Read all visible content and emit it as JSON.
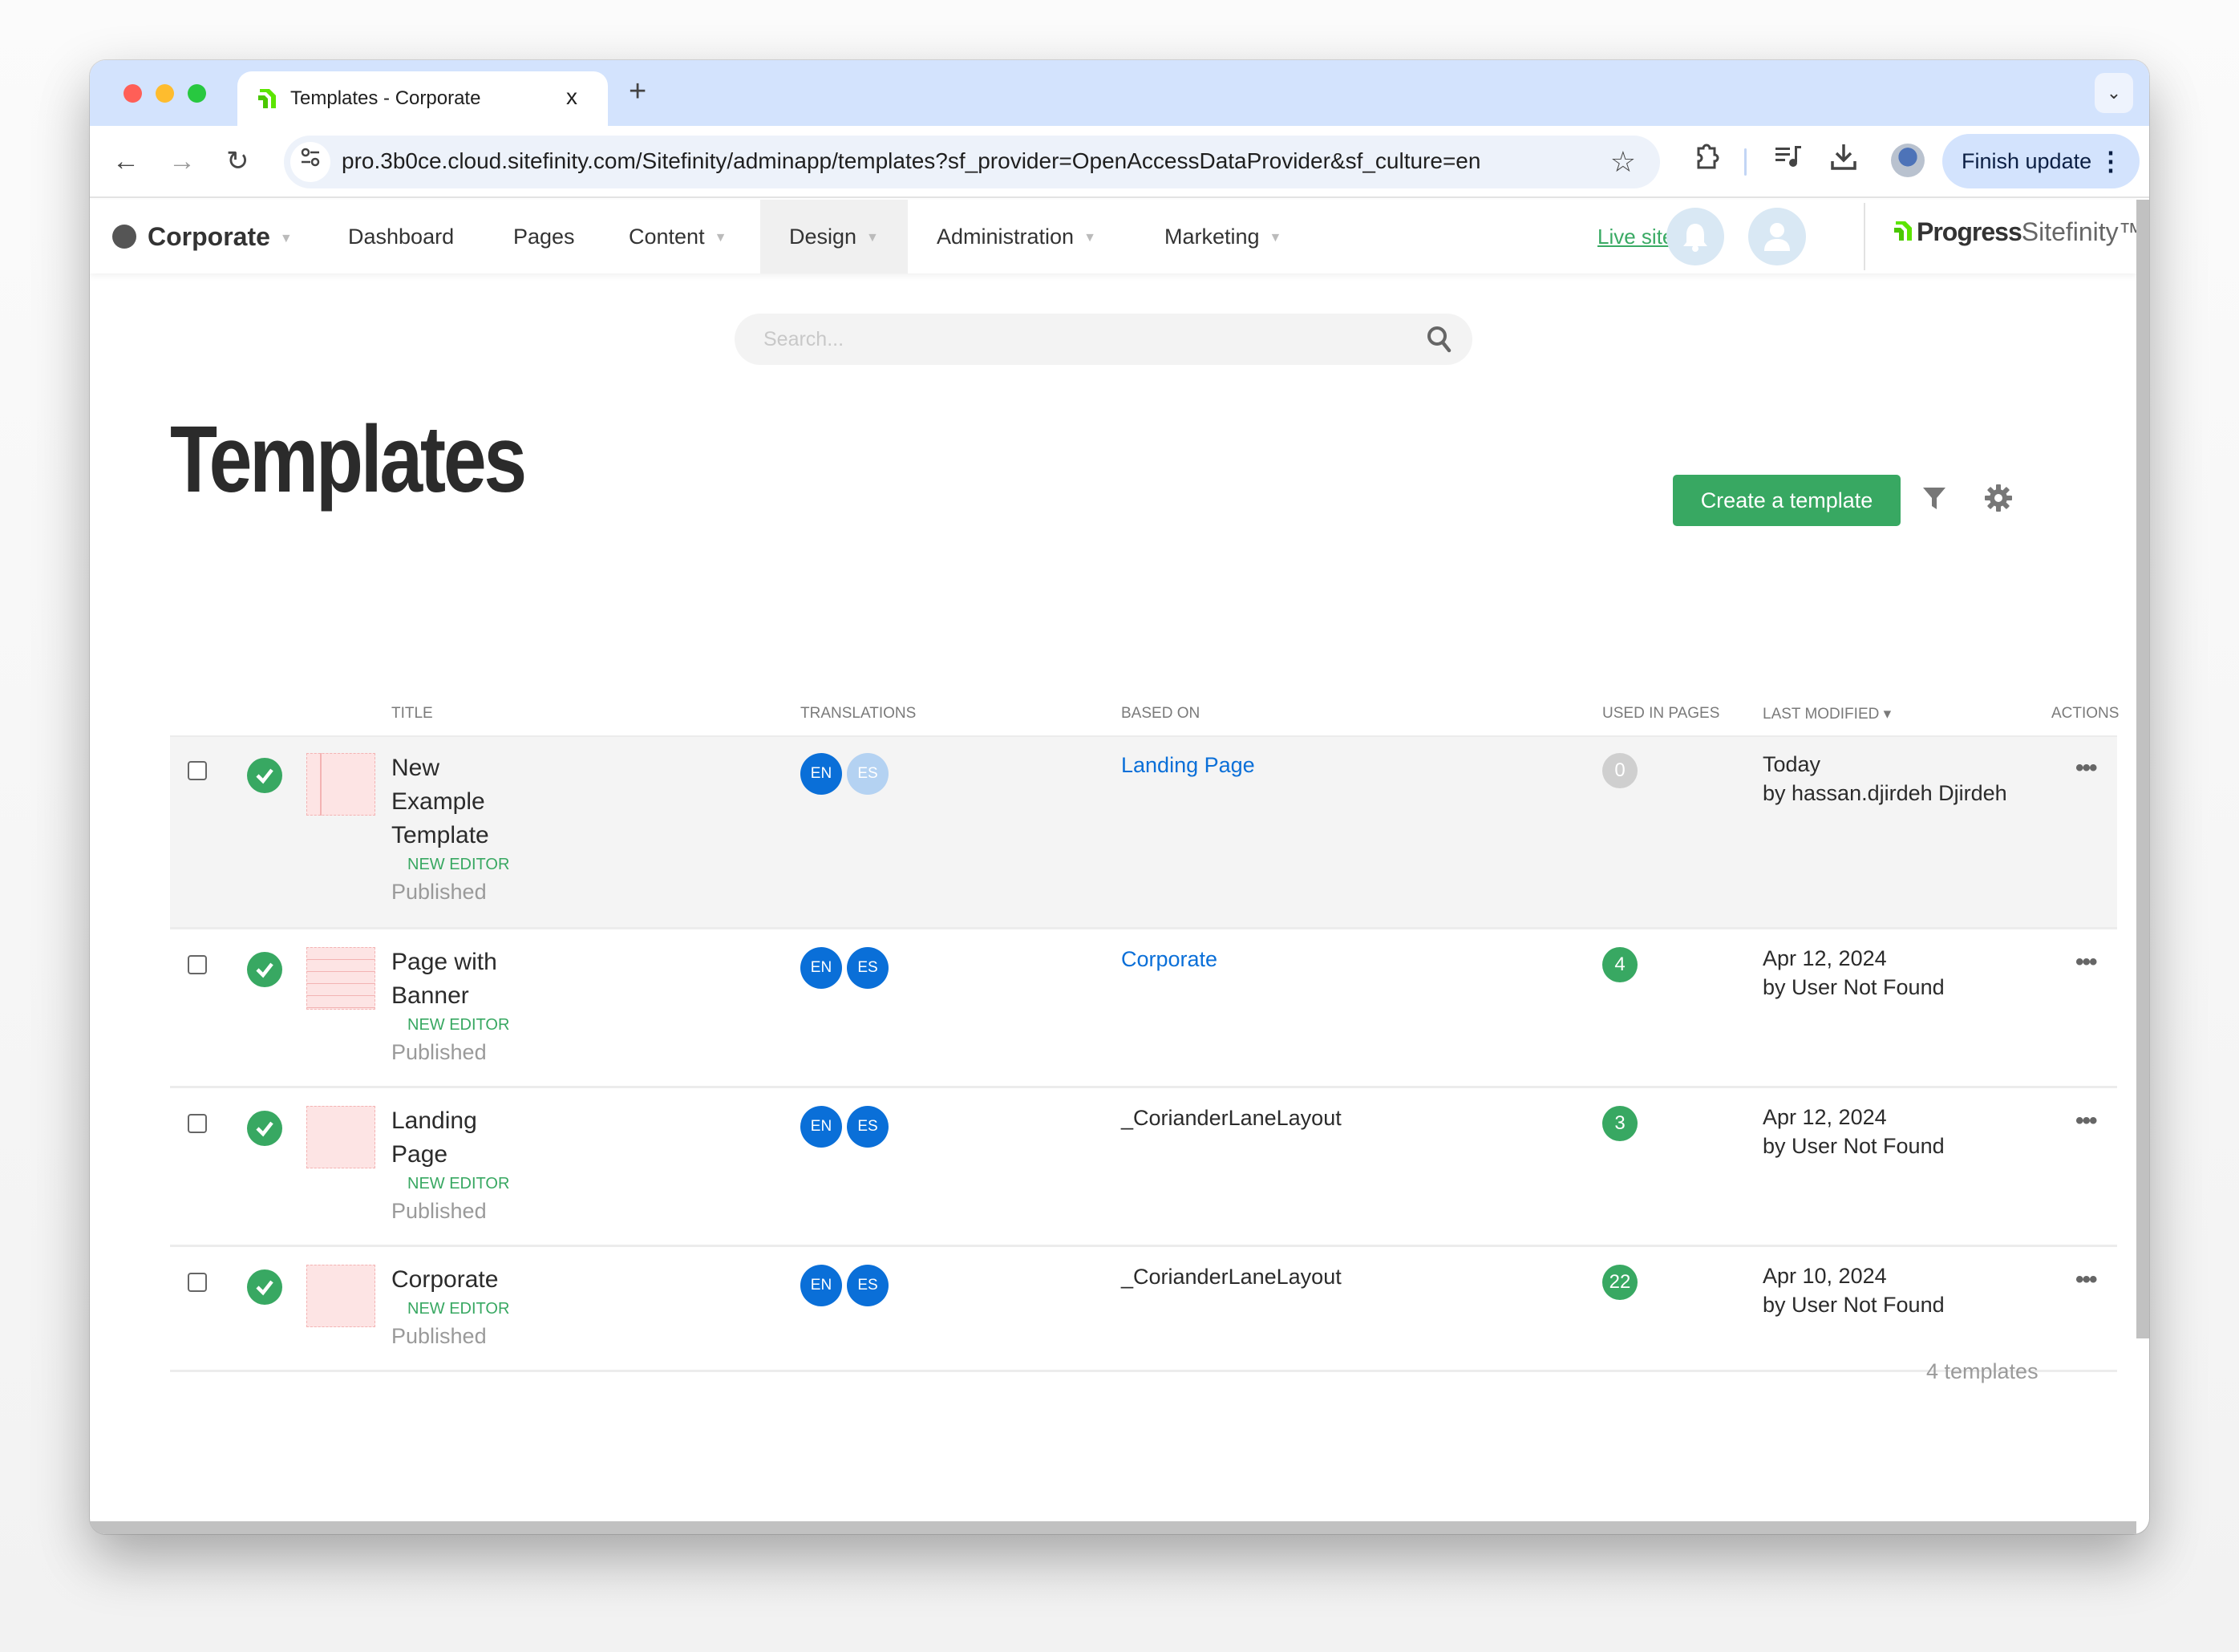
{
  "browser": {
    "tab_title": "Templates - Corporate",
    "tab_close": "x",
    "new_tab": "+",
    "url": "pro.3b0ce.cloud.sitefinity.com/Sitefinity/adminapp/templates?sf_provider=OpenAccessDataProvider&sf_culture=en",
    "finish_update": "Finish update",
    "menu_dots": "⋮",
    "tab_menu": "⌄",
    "back": "←",
    "forward": "→",
    "reload": "↻",
    "star": "☆",
    "site_info": "⚙"
  },
  "appnav": {
    "site": "Corporate",
    "items": [
      "Dashboard",
      "Pages",
      "Content",
      "Design",
      "Administration",
      "Marketing"
    ],
    "live_site": "Live site",
    "logo_progress": "Progress",
    "logo_sitefinity": "Sitefinity™"
  },
  "search": {
    "placeholder": "Search..."
  },
  "page": {
    "title": "Templates",
    "create_button": "Create a template",
    "footer_count": "4 templates"
  },
  "table": {
    "columns": {
      "title": "Title",
      "translations": "Translations",
      "based_on": "Based on",
      "used_in_pages": "Used in pages",
      "last_modified": "Last modified ▾",
      "actions": "Actions"
    },
    "rows": [
      {
        "title": "New Example Template",
        "badge": "NEW EDITOR",
        "status": "Published",
        "langs": [
          "EN",
          "ES"
        ],
        "based_on": "Landing Page",
        "used": "0",
        "date": "Today",
        "by": "by hassan.djirdeh Djirdeh",
        "actions": "•••"
      },
      {
        "title": "Page with Banner",
        "badge": "NEW EDITOR",
        "status": "Published",
        "langs": [
          "EN",
          "ES"
        ],
        "based_on": "Corporate",
        "used": "4",
        "date": "Apr 12, 2024",
        "by": "by User Not Found",
        "actions": "•••"
      },
      {
        "title": "Landing Page",
        "badge": "NEW EDITOR",
        "status": "Published",
        "langs": [
          "EN",
          "ES"
        ],
        "based_on": "_CorianderLaneLayout",
        "used": "3",
        "date": "Apr 12, 2024",
        "by": "by User Not Found",
        "actions": "•••"
      },
      {
        "title": "Corporate",
        "badge": "NEW EDITOR",
        "status": "Published",
        "langs": [
          "EN",
          "ES"
        ],
        "based_on": "_CorianderLaneLayout",
        "used": "22",
        "date": "Apr 10, 2024",
        "by": "by User Not Found",
        "actions": "•••"
      }
    ]
  },
  "colors": {
    "accent_green": "#38a862",
    "link_blue": "#0a6fd8",
    "chrome_blue": "#d3e3fd"
  }
}
